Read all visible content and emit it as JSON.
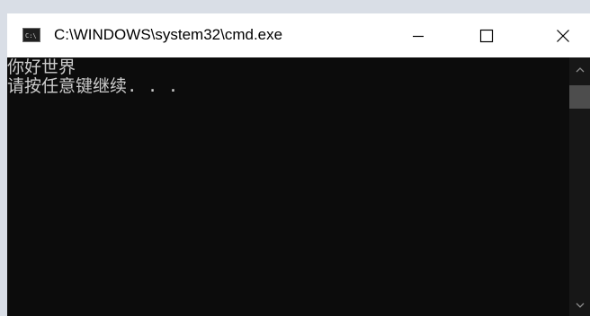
{
  "window": {
    "title": "C:\\WINDOWS\\system32\\cmd.exe",
    "app_icon": "cmd-icon",
    "controls": {
      "minimize_icon": "minimize-icon",
      "maximize_icon": "maximize-icon",
      "close_icon": "close-icon"
    }
  },
  "console": {
    "lines": [
      "你好世界",
      "请按任意键继续. . ."
    ],
    "colors": {
      "background": "#0c0c0c",
      "text": "#cccccc"
    }
  },
  "scrollbar": {
    "up_icon": "chevron-up-icon",
    "down_icon": "chevron-down-icon",
    "position": 0
  }
}
